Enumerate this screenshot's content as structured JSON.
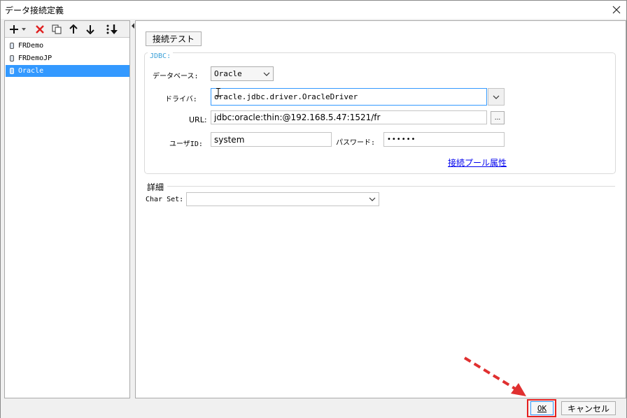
{
  "window": {
    "title": "データ接続定義"
  },
  "toolbar": {
    "icons": [
      "add-icon",
      "dropdown-arrow-icon",
      "delete-icon",
      "copy-icon",
      "move-up-icon",
      "move-down-icon",
      "sort-icon"
    ]
  },
  "connections": [
    {
      "name": "FRDemo",
      "selected": false
    },
    {
      "name": "FRDemoJP",
      "selected": false
    },
    {
      "name": "Oracle",
      "selected": true
    }
  ],
  "form": {
    "test_button": "接続テスト",
    "jdbc_group": "JDBC:",
    "database_label": "データベース:",
    "database_value": "Oracle",
    "driver_label": "ドライバ:",
    "driver_value": "oracle.jdbc.driver.OracleDriver",
    "url_label": "URL:",
    "url_value": "jdbc:oracle:thin:@192.168.5.47:1521/fr",
    "url_browse": "...",
    "user_label": "ユーザID:",
    "user_value": "system",
    "password_label": "パスワード:",
    "password_value": "••••••",
    "pool_link": "接続プール属性",
    "details_group": "詳細",
    "charset_label": "Char Set:",
    "charset_value": ""
  },
  "footer": {
    "ok": "OK",
    "cancel": "キャンセル"
  },
  "colors": {
    "selection": "#3399ff",
    "link": "#0000ee",
    "highlight_box": "#e52020",
    "arrow": "#e03030"
  }
}
